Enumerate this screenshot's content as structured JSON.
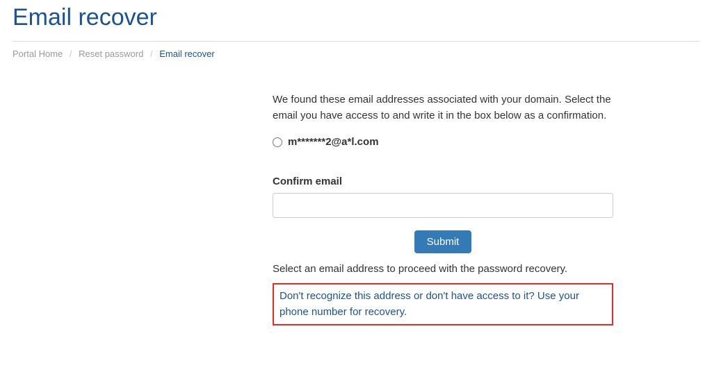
{
  "page": {
    "title": "Email recover"
  },
  "breadcrumb": {
    "home": "Portal Home",
    "reset": "Reset password",
    "current": "Email recover"
  },
  "content": {
    "intro": "We found these email addresses associated with your domain. Select the email you have access to and write it in the box below as a confirmation.",
    "email_options": [
      "m*******2@a*l.com"
    ],
    "confirm_label": "Confirm email",
    "confirm_value": "",
    "confirm_placeholder": "",
    "submit_label": "Submit",
    "help_text": "Select an email address to proceed with the password recovery.",
    "alt_recovery_text": "Don't recognize this address or don't have access to it? Use your phone number for recovery."
  }
}
